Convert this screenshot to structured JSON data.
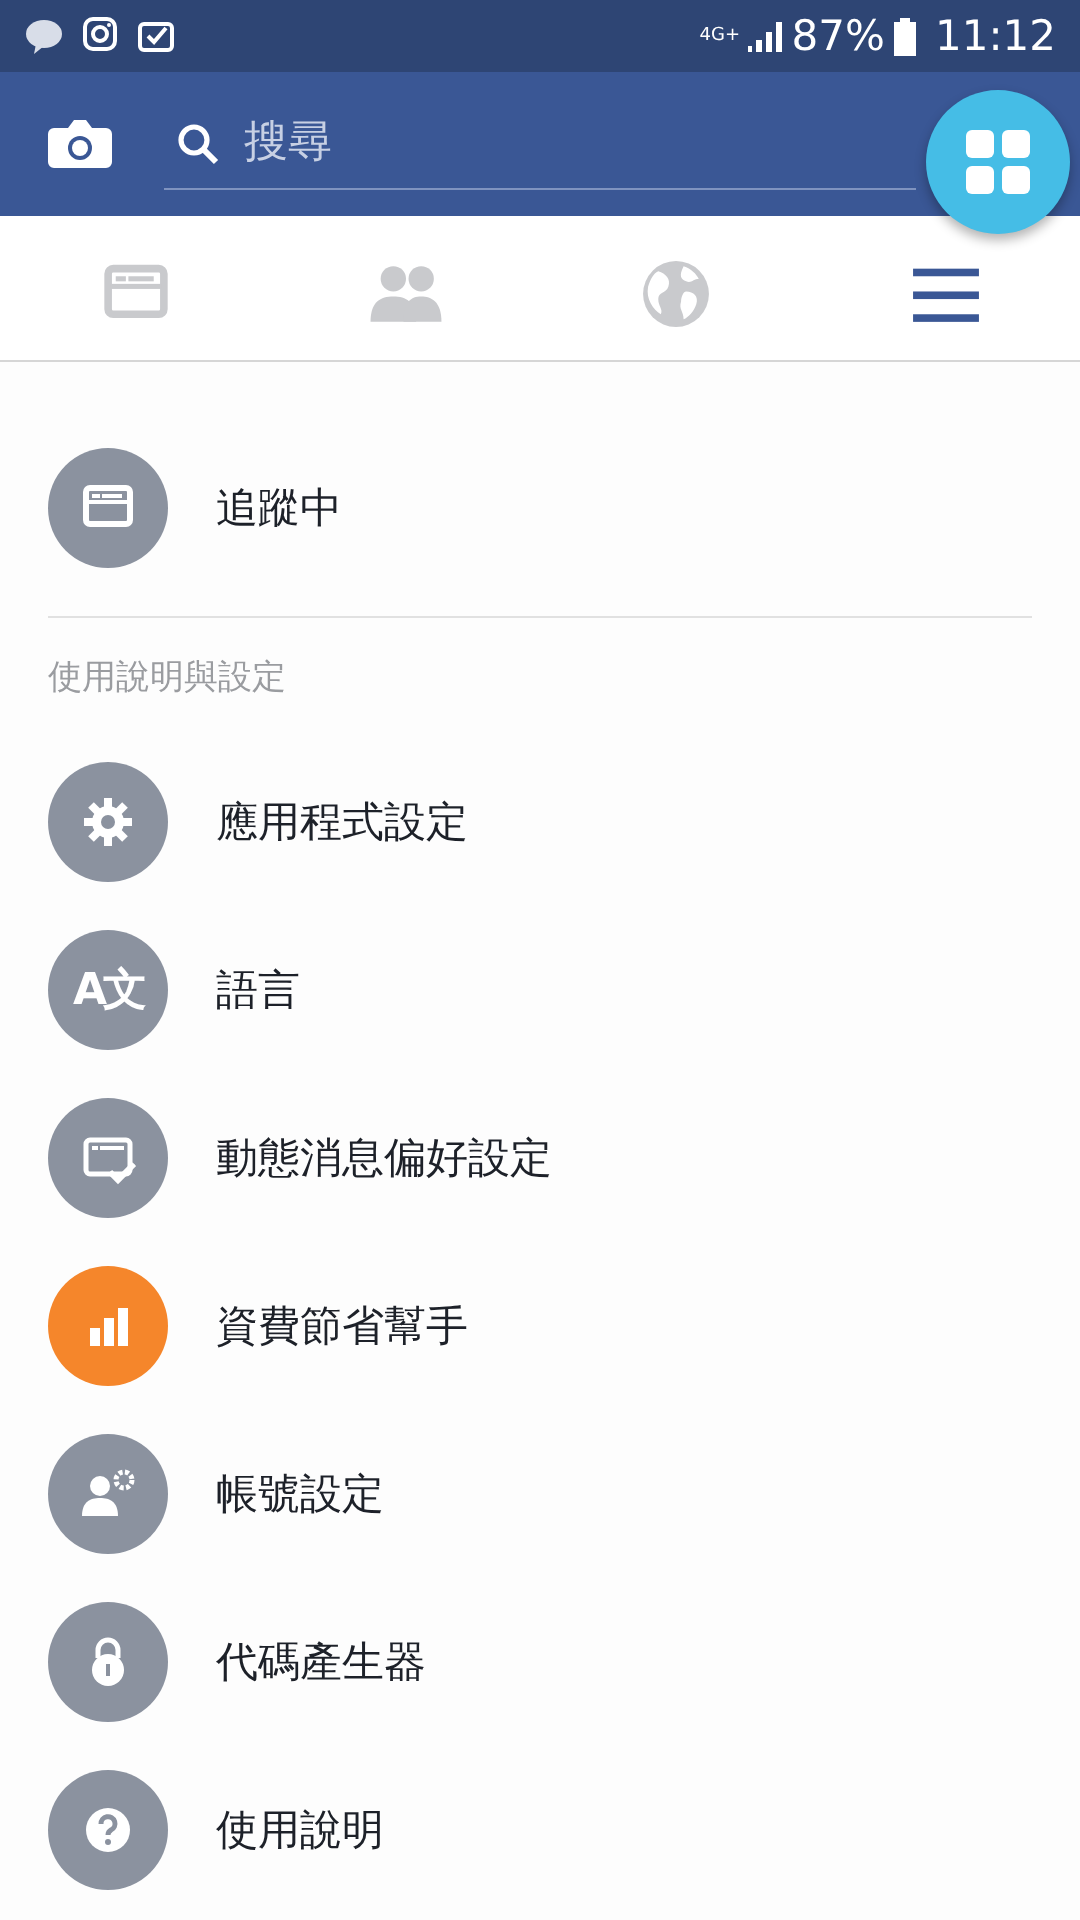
{
  "status_bar": {
    "network": "4G+",
    "battery": "87%",
    "time": "11:12"
  },
  "header": {
    "search": {
      "placeholder": "搜尋"
    }
  },
  "tabs": [
    {
      "kind": "feed",
      "selected": false
    },
    {
      "kind": "friends",
      "selected": false
    },
    {
      "kind": "globe",
      "selected": false
    },
    {
      "kind": "menu",
      "selected": true
    }
  ],
  "sections": [
    {
      "items": [
        {
          "kind": "feed",
          "label": "追蹤中",
          "color": "#8b929f"
        }
      ]
    },
    {
      "title": "使用說明與設定",
      "items": [
        {
          "kind": "gear",
          "label": "應用程式設定",
          "color": "#8b929f"
        },
        {
          "kind": "translate",
          "glyph": "A文",
          "label": "語言",
          "color": "#8b929f"
        },
        {
          "kind": "news",
          "label": "動態消息偏好設定",
          "color": "#8b929f"
        },
        {
          "kind": "bars",
          "label": "資費節省幫手",
          "color": "#f5862b"
        },
        {
          "kind": "account",
          "label": "帳號設定",
          "color": "#8b929f"
        },
        {
          "kind": "lock",
          "label": "代碼產生器",
          "color": "#8b929f"
        },
        {
          "kind": "help",
          "label": "使用說明",
          "color": "#8b929f"
        }
      ]
    }
  ]
}
